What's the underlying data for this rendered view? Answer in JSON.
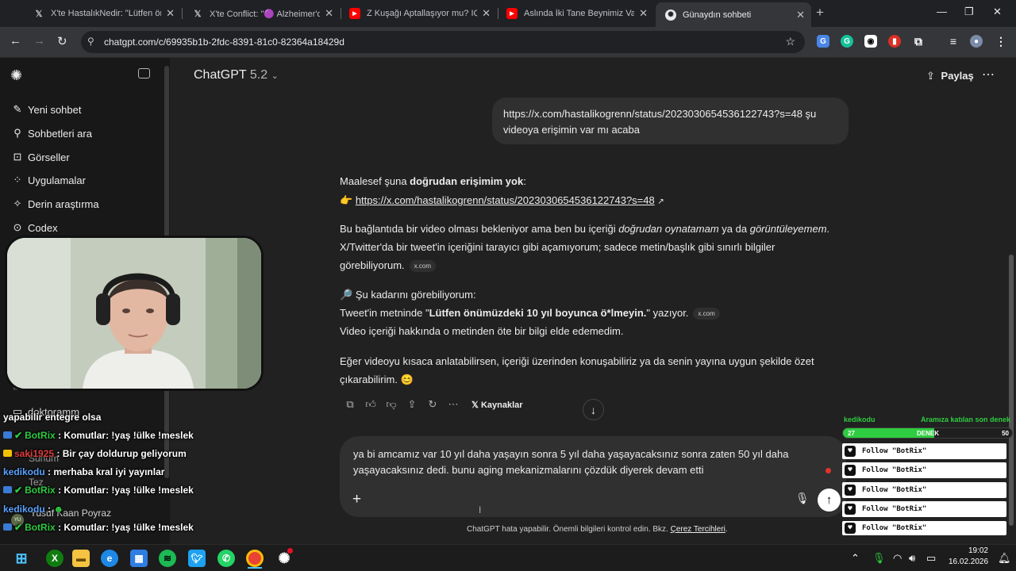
{
  "browser": {
    "tabs": [
      {
        "title": "X'te HastalıkNedir: \"Lütfen önü",
        "icon": "x-logo-icon"
      },
      {
        "title": "X'te Conflict: \"🟣 Alzheimer'da",
        "icon": "x-logo-icon"
      },
      {
        "title": "Z Kuşağı Aptallaşıyor mu? IQ Te",
        "icon": "youtube-icon"
      },
      {
        "title": "Aslında İki Tane Beynimiz Var! T",
        "icon": "youtube-icon"
      },
      {
        "title": "Günaydın sohbeti",
        "icon": "chatgpt-icon",
        "active": true
      }
    ],
    "url": "chatgpt.com/c/69935b1b-2fdc-8391-81c0-82364a18429d"
  },
  "sidebar": {
    "items": [
      {
        "label": "Yeni sohbet",
        "icon": "edit-icon"
      },
      {
        "label": "Sohbetleri ara",
        "icon": "search-icon"
      },
      {
        "label": "Görseller",
        "icon": "image-icon"
      },
      {
        "label": "Uygulamalar",
        "icon": "apps-icon"
      },
      {
        "label": "Derin araştırma",
        "icon": "research-icon"
      },
      {
        "label": "Codex",
        "icon": "codex-icon"
      }
    ],
    "projects": [
      "doktoramm",
      "Sunum",
      "Tez"
    ],
    "user": {
      "name": "Yusuf Kaan Poyraz",
      "initials": "YU"
    }
  },
  "header": {
    "model": "ChatGPT",
    "version": "5.2",
    "share": "Paylaş"
  },
  "chat": {
    "user_message": "https://x.com/hastalikogrenn/status/2023030654536122743?s=48 şu videoya erişimin var mı acaba",
    "assistant": {
      "p1_a": "Maalesef şuna ",
      "p1_b": "doğrudan erişimim yok",
      "p1_c": ":",
      "link": "https://x.com/hastalikogrenn/status/2023030654536122743?s=48",
      "p2_a": "Bu bağlantıda bir video olması bekleniyor ama ben bu içeriği ",
      "p2_b": "doğrudan oynatamam",
      "p2_c": " ya da ",
      "p2_d": "görüntüleyemem",
      "p2_e": ".",
      "p2_line2": "X/Twitter'da bir tweet'in içeriğini tarayıcı gibi açamıyorum; sadece metin/başlık gibi sınırlı bilgiler",
      "p2_line3": "görebiliyorum.",
      "source_chip": "x.com",
      "p3_head": "Şu kadarını görebiliyorum:",
      "p3_a": "Tweet'in metninde \"",
      "p3_b": "Lütfen önümüzdeki 10 yıl boyunca ö*lmeyin.",
      "p3_c": "\" yazıyor.",
      "p3_line3": "Video içeriği hakkında o metinden öte bir bilgi elde edemedim.",
      "p4_line1": "Eğer videoyu kısaca anlatabilirsen, içeriği üzerinden konuşabiliriz ya da senin yayına uygun şekilde özet",
      "p4_line2": "çıkarabilirim. 😊"
    },
    "sources_label": "Kaynaklar"
  },
  "composer": {
    "text": "ya bi amcamız var 10 yıl daha yaşayın sonra 5 yıl daha yaşayacaksınız sonra zaten 50 yıl daha yaşayacaksınız dedi. bunu aging mekanizmalarını çözdük diyerek devam etti"
  },
  "footer": {
    "note": "ChatGPT hata yapabilir. Önemli bilgileri kontrol edin. Bkz. ",
    "link": "Çerez Tercihleri",
    "end": "."
  },
  "stream_chat": {
    "lines": [
      {
        "user": "",
        "text": "yapabilir entegre olsa"
      },
      {
        "user": "BotRix",
        "text": ": Komutlar: !yaş !ülke !meslek"
      },
      {
        "user": "saki1925",
        "text": ": Bir çay doldurup geliyorum"
      },
      {
        "user": "kedikodu",
        "text": ": merhaba kral iyi yayınlar"
      },
      {
        "user": "BotRix",
        "text": ": Komutlar: !yaş !ülke !meslek"
      },
      {
        "user": "kedikodu",
        "text": ":"
      },
      {
        "user": "BotRix",
        "text": ": Komutlar: !yaş !ülke !meslek"
      }
    ]
  },
  "follow_widget": {
    "last_follower": "kedikodu",
    "title": "Aramıza katılan son denek",
    "goal_current": "27",
    "goal_label": "DENEK",
    "goal_target": "50",
    "goal_progress": 0.54,
    "alerts": [
      "Follow \"BotRix\"",
      "Follow \"BotRix\"",
      "Follow \"BotRix\"",
      "Follow \"BotRix\"",
      "Follow \"BotRix\""
    ]
  },
  "taskbar": {
    "time": "19:02",
    "date": "16.02.2026"
  },
  "colors": {
    "accent_green": "#2ecc40",
    "chat_bg": "#212121",
    "sidebar_bg": "#181818"
  }
}
